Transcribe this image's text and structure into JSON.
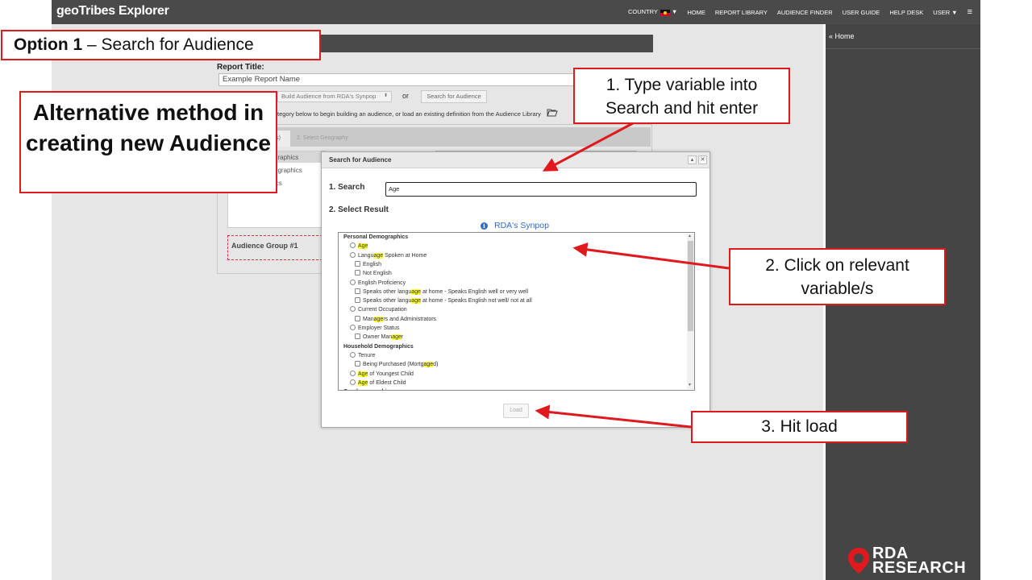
{
  "app": {
    "title": "geoTribes Explorer",
    "nav": {
      "country": "COUNTRY",
      "home": "HOME",
      "report_library": "REPORT LIBRARY",
      "audience_finder": "AUDIENCE FINDER",
      "user_guide": "USER GUIDE",
      "help_desk": "HELP DESK",
      "user": "USER",
      "menu": "≡"
    },
    "sidepanel": {
      "home": "«  Home"
    }
  },
  "report": {
    "title_label": "Report Title:",
    "title_value": "Example Report Name",
    "build_select": "Build Audience from RDA's Synpop",
    "or_text": "or",
    "search_button": "Search for Audience",
    "instruction": "tegory below to begin building an audience, or load an existing definition from the Audience Library",
    "tab1": "s)",
    "tab2": "2. Select Geography",
    "categories": [
      "graphics",
      "ographics",
      "ics"
    ],
    "audience_group": "Audience Group #1"
  },
  "modal": {
    "title": "Search for Audience",
    "step1_label": "1. Search",
    "search_value": "Age",
    "step2_label": "2. Select Result",
    "source_name": "RDA's Synpop",
    "load_label": "Load",
    "results": [
      {
        "type": "group",
        "text": "Personal Demographics"
      },
      {
        "type": "radio",
        "pre": "",
        "hl": "Age",
        "post": ""
      },
      {
        "type": "radio",
        "pre": "Langu",
        "hl": "age",
        "post": " Spoken at Home"
      },
      {
        "type": "check",
        "pre": "English",
        "hl": "",
        "post": ""
      },
      {
        "type": "check",
        "pre": "Not English",
        "hl": "",
        "post": ""
      },
      {
        "type": "radio",
        "pre": "English Proficiency",
        "hl": "",
        "post": ""
      },
      {
        "type": "check",
        "pre": "Speaks other langu",
        "hl": "age",
        "post": " at home - Speaks English well or very well"
      },
      {
        "type": "check",
        "pre": "Speaks other langu",
        "hl": "age",
        "post": " at home - Speaks English not well/ not at all"
      },
      {
        "type": "radio",
        "pre": "Current Occupation",
        "hl": "",
        "post": ""
      },
      {
        "type": "check",
        "pre": "Man",
        "hl": "age",
        "post": "rs and Administrators"
      },
      {
        "type": "radio",
        "pre": "Employer Status",
        "hl": "",
        "post": ""
      },
      {
        "type": "check",
        "pre": "Owner Man",
        "hl": "age",
        "post": "r"
      },
      {
        "type": "group",
        "text": "Household Demographics"
      },
      {
        "type": "radio",
        "pre": "Tenure",
        "hl": "",
        "post": ""
      },
      {
        "type": "check",
        "pre": "Being Purchased (Mortg",
        "hl": "age",
        "post": "d)"
      },
      {
        "type": "radio",
        "pre": "",
        "hl": "Age",
        "post": " of Youngest Child"
      },
      {
        "type": "radio",
        "pre": "",
        "hl": "Age",
        "post": " of Eldest Child"
      },
      {
        "type": "group",
        "text": "Geodemographics"
      }
    ]
  },
  "callouts": {
    "option_bold": "Option 1",
    "option_rest": " – Search for Audience",
    "alternative": "Alternative method in creating new Audience",
    "step1_line1": "1. Type variable into",
    "step1_line2": "Search and hit enter",
    "step2_line1": "2. Click on relevant",
    "step2_line2": "variable/s",
    "step3": "3. Hit load"
  },
  "logo": {
    "line1": "RDA",
    "line2": "RESEARCH"
  },
  "colors": {
    "callout_border": "#e0191e",
    "highlight": "#ffff3a",
    "link_blue": "#2f6cc4",
    "nav_bg": "#4a4a4a"
  }
}
